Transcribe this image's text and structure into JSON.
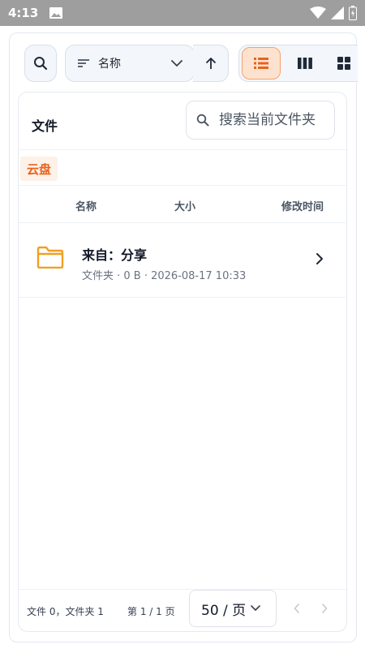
{
  "status_bar": {
    "time": "4:13"
  },
  "toolbar": {
    "sort_label": "名称",
    "icons": [
      "search-icon",
      "sort-lines-icon",
      "chevron-down-icon",
      "arrow-up-icon",
      "list-view-icon",
      "column-view-icon",
      "grid-view-icon"
    ]
  },
  "panel": {
    "title": "文件",
    "search_placeholder": "搜索当前文件夹",
    "breadcrumb": "云盘",
    "columns": {
      "name": "名称",
      "size": "大小",
      "modified": "修改时间"
    }
  },
  "files": [
    {
      "name": "来自：分享",
      "meta": "文件夹 · 0 B · 2026-08-17 10:33",
      "icon": "folder-icon"
    }
  ],
  "footer": {
    "counts": "文件 0，文件夹 1",
    "page_info": "第 1 / 1 页",
    "page_size": "50 / 页"
  },
  "colors": {
    "accent": "#e8621d",
    "accent_bg": "#fde3cf",
    "folder": "#f0a020",
    "status_bar": "#9e9e9e"
  }
}
